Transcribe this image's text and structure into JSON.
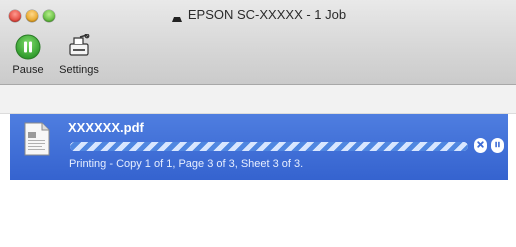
{
  "window": {
    "title": "EPSON SC-XXXXX - 1 Job"
  },
  "toolbar": {
    "pause_label": "Pause",
    "settings_label": "Settings"
  },
  "colors": {
    "selection": "#3d6bd6",
    "pause_button": "#3ea83a"
  },
  "job": {
    "name": "XXXXXX.pdf",
    "status": "Printing - Copy 1 of 1, Page 3 of 3, Sheet 3 of 3.",
    "progress": 1.0
  },
  "icons": {
    "printer": "printer-icon",
    "pause": "pause-icon",
    "settings": "settings-icon",
    "document": "document-icon",
    "delete": "delete-icon",
    "hold": "hold-icon"
  }
}
